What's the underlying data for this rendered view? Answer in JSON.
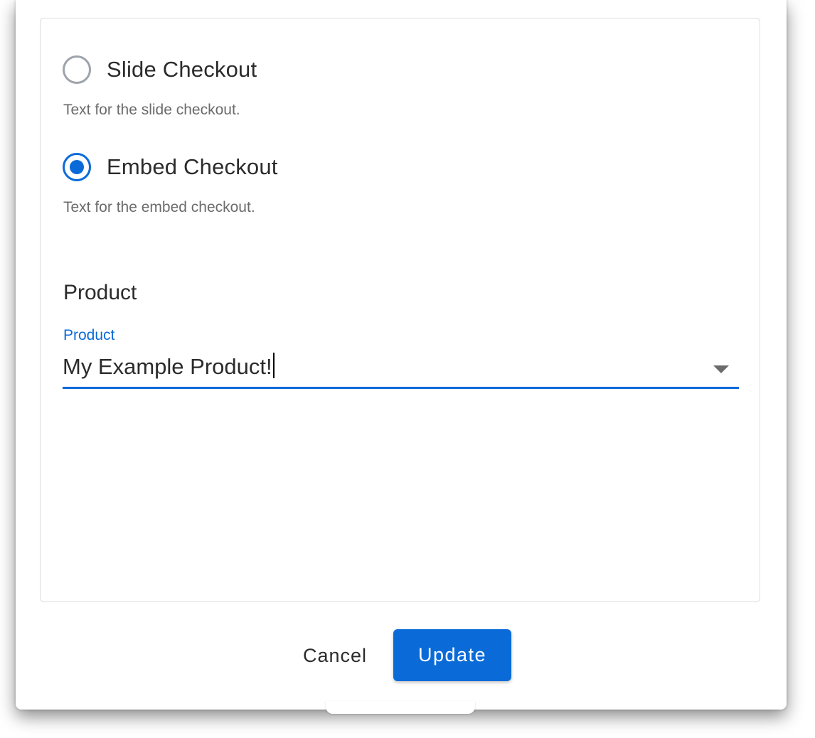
{
  "checkout_options": [
    {
      "label": "Slide Checkout",
      "description": "Text for the slide checkout.",
      "selected": false
    },
    {
      "label": "Embed Checkout",
      "description": "Text for the embed checkout.",
      "selected": true
    }
  ],
  "product_section": {
    "title": "Product",
    "field_label": "Product",
    "value": "My Example Product!"
  },
  "actions": {
    "cancel_label": "Cancel",
    "update_label": "Update"
  },
  "colors": {
    "accent": "#0a6bd8",
    "radio_unselected": "#9ea3ab",
    "text_primary": "#2b2b2b",
    "text_secondary": "#6b6b6b"
  },
  "icons": {
    "dropdown": "triangle-down-icon"
  }
}
